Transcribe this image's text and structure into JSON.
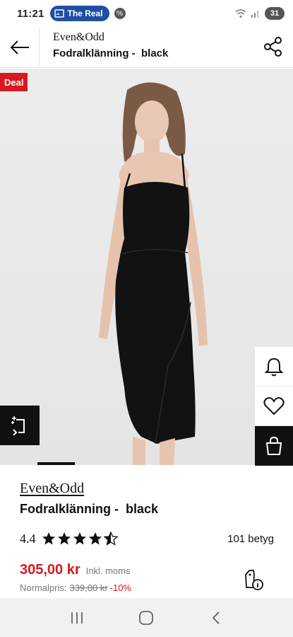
{
  "status_bar": {
    "time": "11:21",
    "notification": "The Real",
    "badge": "%",
    "battery": "31"
  },
  "header": {
    "brand": "Even&Odd",
    "title": "Fodralklänning -  black"
  },
  "image": {
    "deal_label": "Deal",
    "current_slide": 2
  },
  "product": {
    "brand": "Even&Odd",
    "title": "Fodralklänning -  black",
    "rating": "4.4",
    "rating_value": 4.4,
    "reviews": "101 betyg",
    "price": "305,00 kr",
    "vat_label": "Inkl. moms",
    "normal_label": "Normalpris:",
    "normal_price": "339,00 kr",
    "discount": "-10%"
  },
  "colors": {
    "accent_red": "#d9181f",
    "notification_blue": "#1f4fa3",
    "text": "#111111"
  },
  "icons": {
    "back": "arrow-left-icon",
    "share": "share-icon",
    "alert": "bell-icon",
    "favorite": "heart-icon",
    "cart": "shopping-bag-icon",
    "compare": "compare-icon",
    "price_info": "price-tag-info-icon"
  }
}
